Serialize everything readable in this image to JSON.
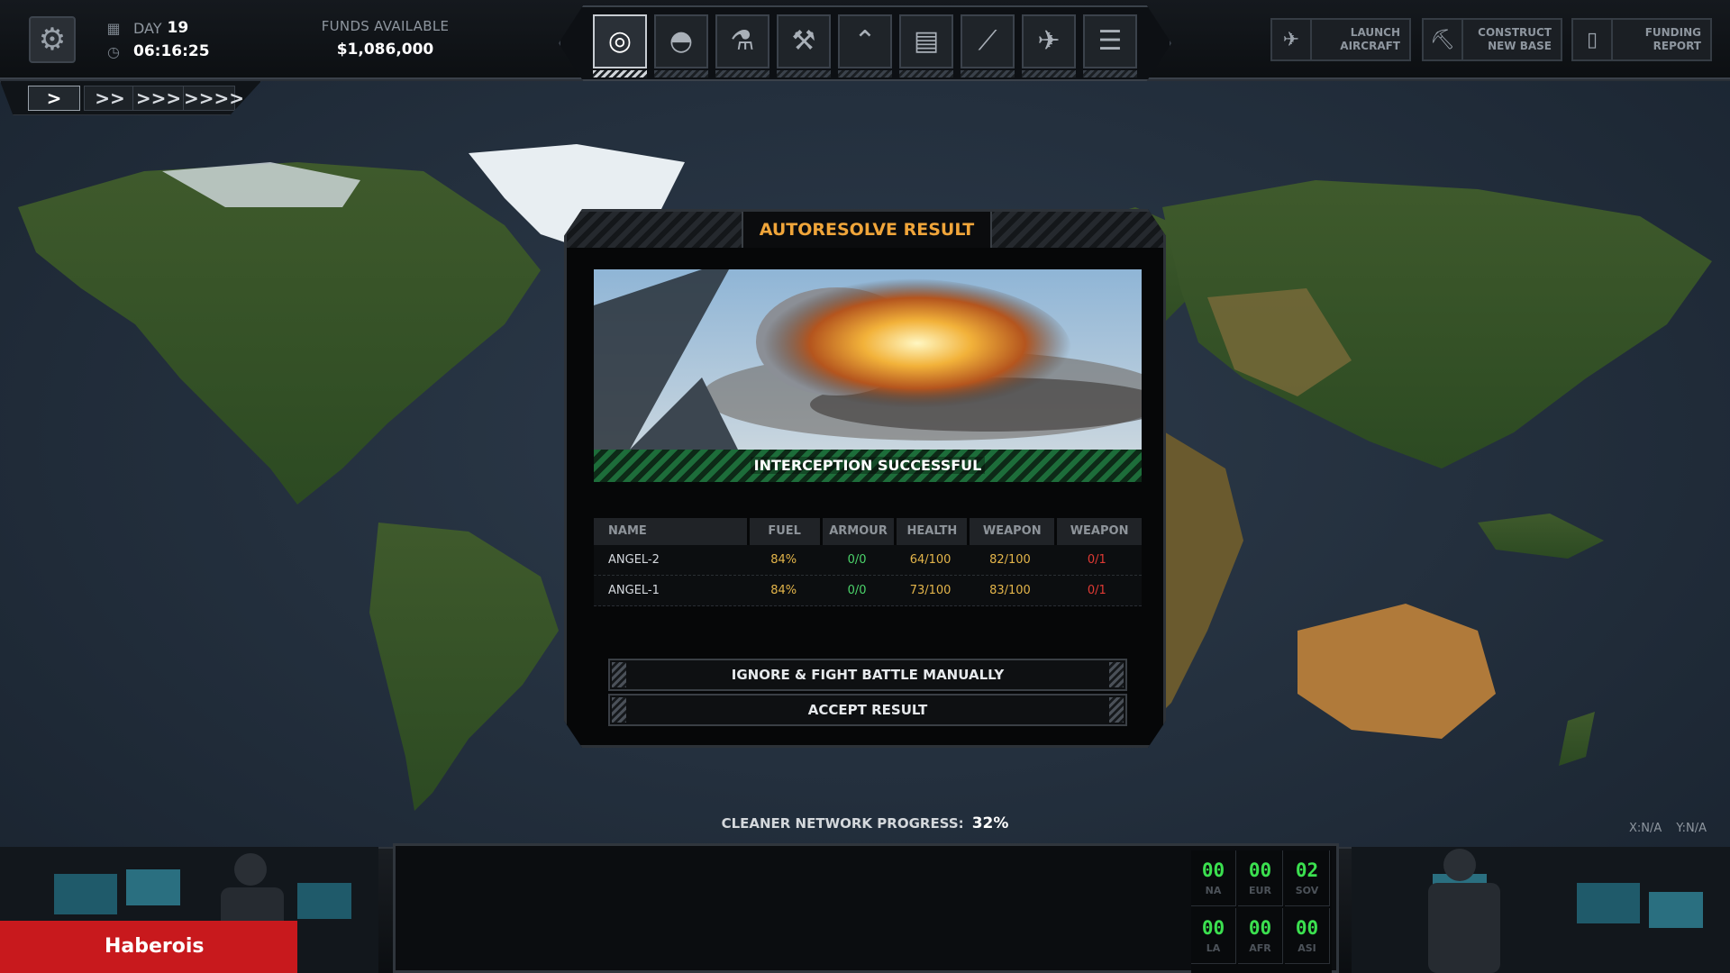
{
  "top": {
    "day_label": "DAY",
    "day_value": "19",
    "time": "06:16:25",
    "funds_label": "FUNDS AVAILABLE",
    "funds_value": "$1,086,000"
  },
  "speed_buttons": [
    ">",
    ">>",
    ">>>",
    ">>>>"
  ],
  "nav_icons": [
    "globe-icon",
    "base-dome-icon",
    "microscope-icon",
    "wrench-icon",
    "rank-chevron-icon",
    "storage-icon",
    "rifle-icon",
    "jet-icon",
    "archive-icon"
  ],
  "actions": [
    {
      "label_1": "LAUNCH",
      "label_2": "AIRCRAFT",
      "icon": "aircraft-icon"
    },
    {
      "label_1": "CONSTRUCT",
      "label_2": "NEW BASE",
      "icon": "excavator-icon"
    },
    {
      "label_1": "FUNDING",
      "label_2": "REPORT",
      "icon": "report-icon"
    }
  ],
  "modal": {
    "title": "AUTORESOLVE RESULT",
    "banner": "INTERCEPTION SUCCESSFUL",
    "columns": [
      "NAME",
      "FUEL",
      "ARMOUR",
      "HEALTH",
      "WEAPON",
      "WEAPON"
    ],
    "rows": [
      {
        "name": "ANGEL-2",
        "fuel": "84%",
        "armour": "0/0",
        "health": "64/100",
        "weapon1": "82/100",
        "weapon2": "0/1"
      },
      {
        "name": "ANGEL-1",
        "fuel": "84%",
        "armour": "0/0",
        "health": "73/100",
        "weapon1": "83/100",
        "weapon2": "0/1"
      }
    ],
    "button_manual": "IGNORE & FIGHT BATTLE MANUALLY",
    "button_accept": "ACCEPT RESULT"
  },
  "progress": {
    "label": "CLEANER NETWORK PROGRESS:",
    "value": "32%"
  },
  "coords": {
    "x": "X:N/A",
    "y": "Y:N/A"
  },
  "player": "Haberois",
  "regions": [
    {
      "value": "00",
      "label": "NA"
    },
    {
      "value": "00",
      "label": "EUR"
    },
    {
      "value": "02",
      "label": "SOV"
    },
    {
      "value": "00",
      "label": "LA"
    },
    {
      "value": "00",
      "label": "AFR"
    },
    {
      "value": "00",
      "label": "ASI"
    }
  ],
  "colors": {
    "accent_orange": "#f0a53a",
    "success_green": "#1d6d3a",
    "value_yellow": "#e4b54a",
    "value_green": "#4bd36a",
    "value_red": "#e03a34",
    "player_red": "#c8191d",
    "region_green": "#3be04f"
  }
}
